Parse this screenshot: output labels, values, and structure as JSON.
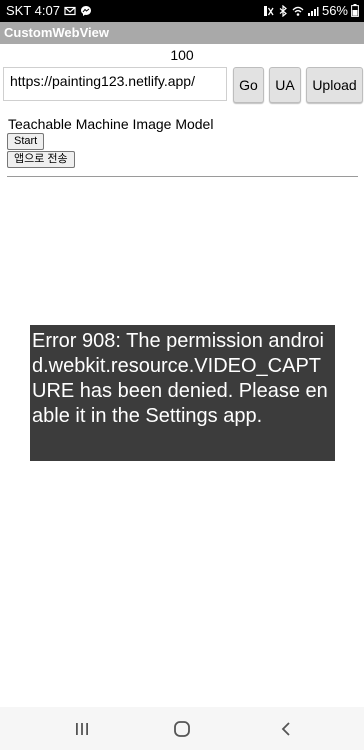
{
  "status_bar": {
    "carrier_time": "SKT 4:07",
    "battery": "56%",
    "icons": [
      "gmail-icon",
      "messenger-icon",
      "mute-icon",
      "bluetooth-icon",
      "wifi-icon",
      "signal-icon",
      "battery-icon"
    ]
  },
  "app": {
    "title": "CustomWebView"
  },
  "counter": "100",
  "toolbar": {
    "url_value": "https://painting123.netlify.app/",
    "go_label": "Go",
    "ua_label": "UA",
    "upload_label": "Upload"
  },
  "page": {
    "title": "Teachable Machine Image Model",
    "start_label": "Start",
    "send_label": "앱으로 전송"
  },
  "toast": {
    "message": "Error 908: The permission android.webkit.resource.VIDEO_CAPTURE has been denied. Please enable it in the Settings app."
  },
  "nav_bar": {
    "icons": [
      "recents-icon",
      "home-icon",
      "back-icon"
    ]
  }
}
